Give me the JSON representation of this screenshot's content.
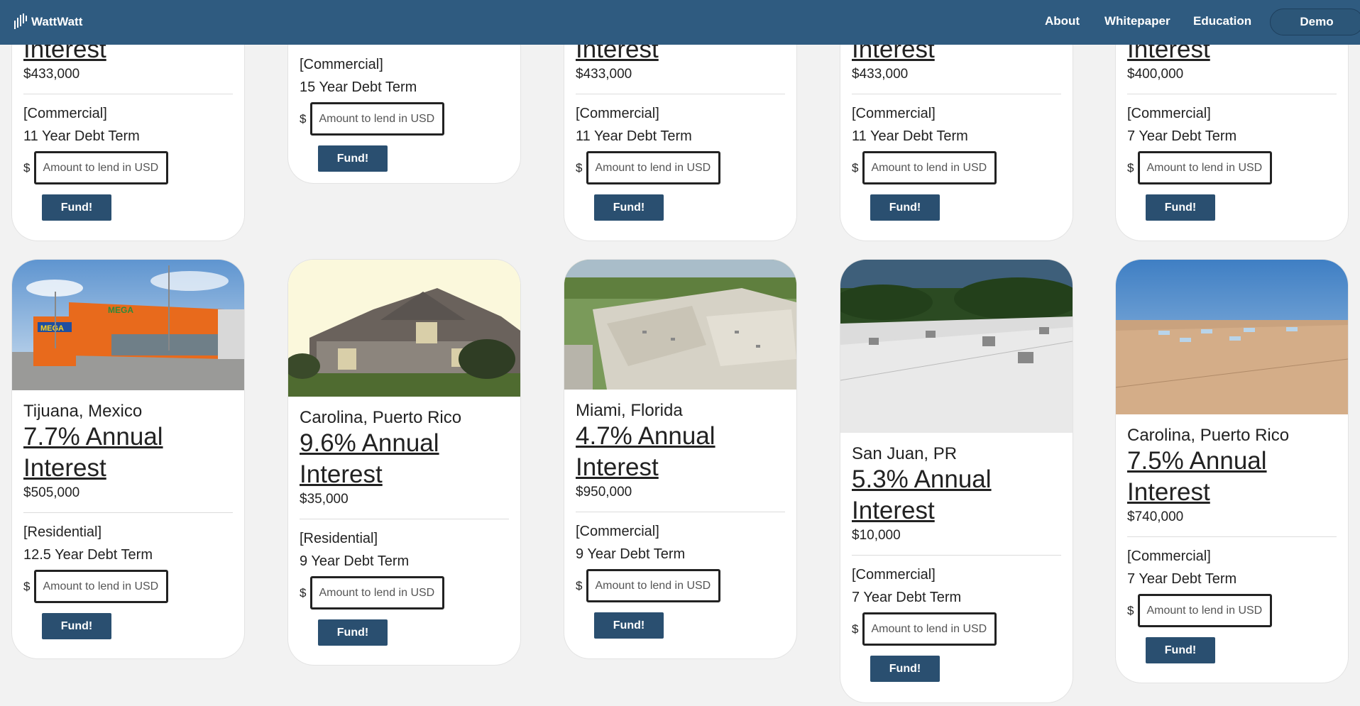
{
  "nav": {
    "brand": "WattWatt",
    "links": [
      "About",
      "Whitepaper",
      "Education"
    ],
    "demo": "Demo"
  },
  "common": {
    "currency": "$",
    "placeholder": "Amount to lend in USD",
    "fund_label": "Fund!"
  },
  "top_row": [
    {
      "rate_tail": "Interest",
      "amount": "$433,000",
      "type": "[Commercial]",
      "term": "11 Year Debt Term"
    },
    {
      "type": "[Commercial]",
      "term": "15 Year Debt Term"
    },
    {
      "rate_tail": "Interest",
      "amount": "$433,000",
      "type": "[Commercial]",
      "term": "11 Year Debt Term"
    },
    {
      "rate_tail": "Interest",
      "amount": "$433,000",
      "type": "[Commercial]",
      "term": "11 Year Debt Term"
    },
    {
      "rate_tail": "Interest",
      "amount": "$400,000",
      "type": "[Commercial]",
      "term": "7 Year Debt Term"
    }
  ],
  "projects": [
    {
      "location": "Tijuana, Mexico",
      "rate_line1": "7.7% Annual",
      "rate_line2": "Interest",
      "amount": "$505,000",
      "type": "[Residential]",
      "term": "12.5 Year Debt Term",
      "image": "store"
    },
    {
      "location": "Carolina, Puerto Rico",
      "rate_line1": "9.6% Annual",
      "rate_line2": "Interest",
      "amount": "$35,000",
      "type": "[Residential]",
      "term": "9 Year Debt Term",
      "image": "house"
    },
    {
      "location": "Miami, Florida",
      "rate_line1": "4.7% Annual",
      "rate_line2": "Interest",
      "amount": "$950,000",
      "type": "[Commercial]",
      "term": "9 Year Debt Term",
      "image": "aerial-roof"
    },
    {
      "location": "San Juan, PR",
      "rate_line1": "5.3% Annual",
      "rate_line2": "Interest",
      "amount": "$10,000",
      "type": "[Commercial]",
      "term": "7 Year Debt Term",
      "image": "white-roof"
    },
    {
      "location": "Carolina, Puerto Rico",
      "rate_line1": "7.5% Annual",
      "rate_line2": "Interest",
      "amount": "$740,000",
      "type": "[Commercial]",
      "term": "7 Year Debt Term",
      "image": "tan-roof"
    }
  ]
}
